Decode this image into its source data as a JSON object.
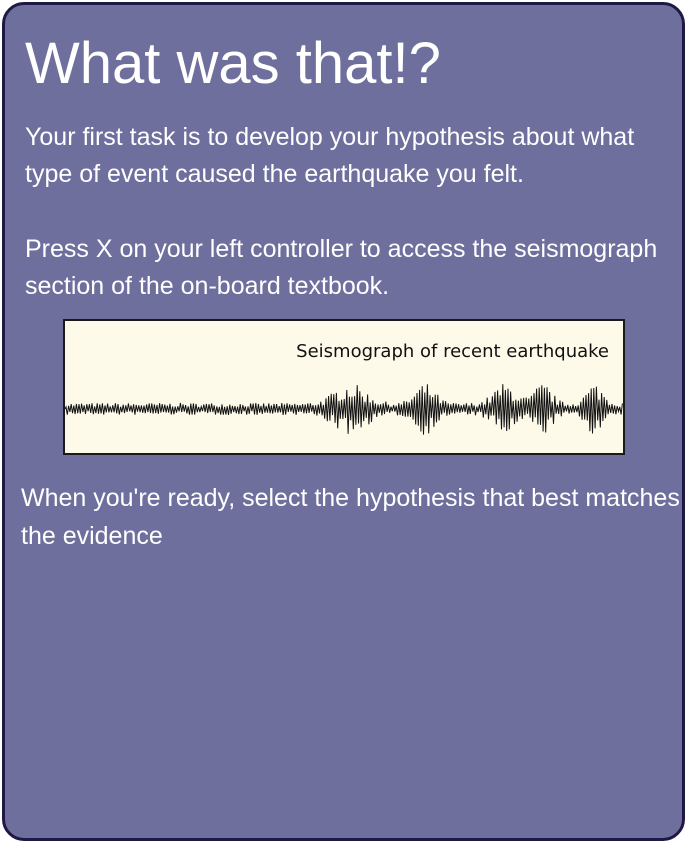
{
  "panel": {
    "title": "What was that!?",
    "paragraphs": [
      "Your first task is to develop your hypothesis about what type of event caused the earthquake you felt.",
      "Press X on your left controller to access the seismograph section of the on-board textbook.",
      "When you're ready, select the hypothesis that best matches the evidence"
    ]
  },
  "seismograph": {
    "caption": "Seismograph of recent earthquake",
    "trace_color": "#111111"
  },
  "colors": {
    "panel_background": "#6f6f9e",
    "panel_border": "#1e1845",
    "seismograph_background": "#fdfaea",
    "text": "#ffffff"
  }
}
